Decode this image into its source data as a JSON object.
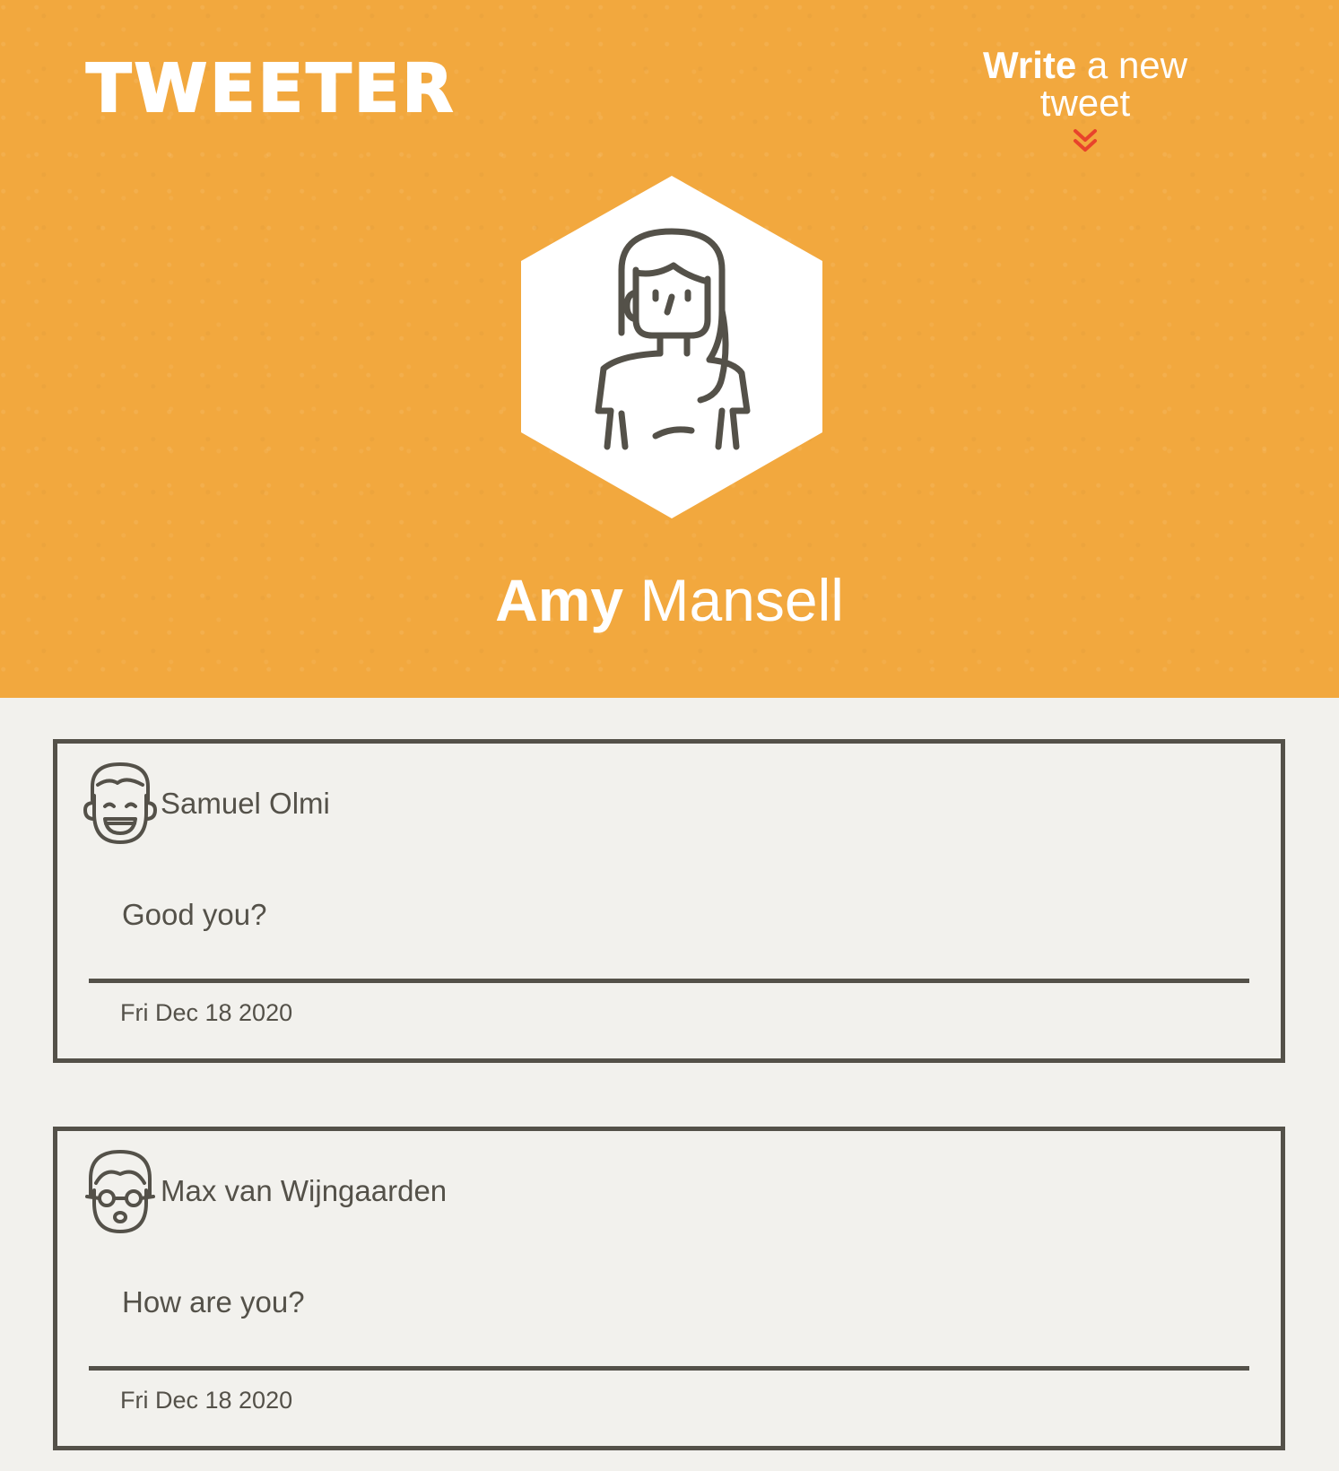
{
  "header": {
    "logo": "TWEETER",
    "compose_bold": "Write",
    "compose_rest": " a new tweet",
    "compose_icon": "chevron-double-down-icon",
    "accent_color": "#f2a83e",
    "arrow_color": "#e8432b"
  },
  "profile": {
    "first_name": "Amy",
    "last_name": "Mansell",
    "avatar_icon": "woman-avatar-icon"
  },
  "tweets": [
    {
      "author": "Samuel Olmi",
      "avatar_icon": "smiling-man-avatar-icon",
      "text": "Good you?",
      "date": "Fri Dec 18 2020"
    },
    {
      "author": "Max van Wijngaarden",
      "avatar_icon": "man-with-glasses-avatar-icon",
      "text": "How are you?",
      "date": "Fri Dec 18 2020"
    }
  ],
  "colors": {
    "page_bg": "#f2f1ed",
    "text": "#545149"
  }
}
